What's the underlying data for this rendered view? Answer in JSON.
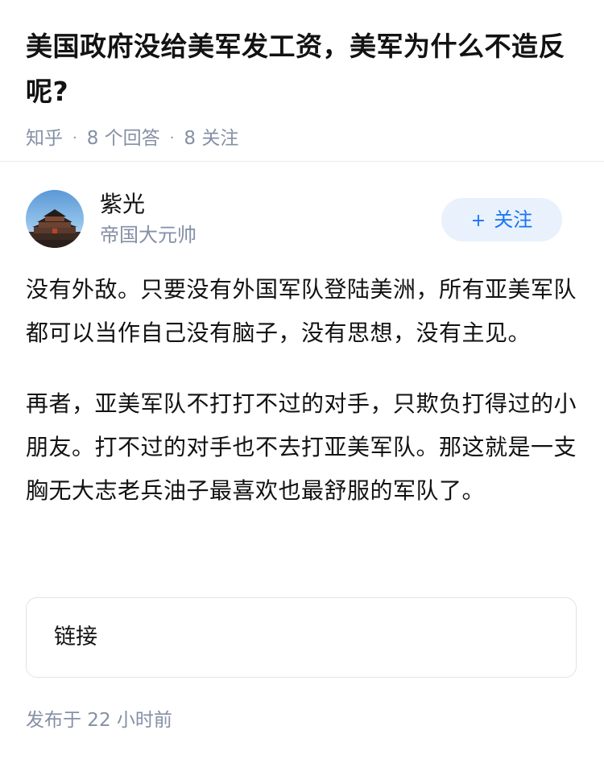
{
  "question": {
    "title": "美国政府没给美军发工资，美军为什么不造反呢?",
    "source": "知乎",
    "answers": "8 个回答",
    "followers": "8 关注"
  },
  "author": {
    "name": "紫光",
    "headline": "帝国大元帅",
    "follow_label": "关注",
    "follow_icon": "plus-icon"
  },
  "answer": {
    "paragraphs": [
      "没有外敌。只要没有外国军队登陆美洲，所有亚美军队都可以当作自己没有脑子，没有思想，没有主见。",
      "再者，亚美军队不打打不过的对手，只欺负打得过的小朋友。打不过的对手也不去打亚美军队。那这就是一支胸无大志老兵油子最喜欢也最舒服的军队了。"
    ]
  },
  "link_card": {
    "label": "链接"
  },
  "publish": {
    "time": "发布于  22 小时前"
  },
  "colors": {
    "primary_text": "#121212",
    "secondary_text": "#8590a6",
    "accent": "#1772f6",
    "follow_button_bg": "#e8f1fc",
    "divider": "#ebebeb"
  }
}
